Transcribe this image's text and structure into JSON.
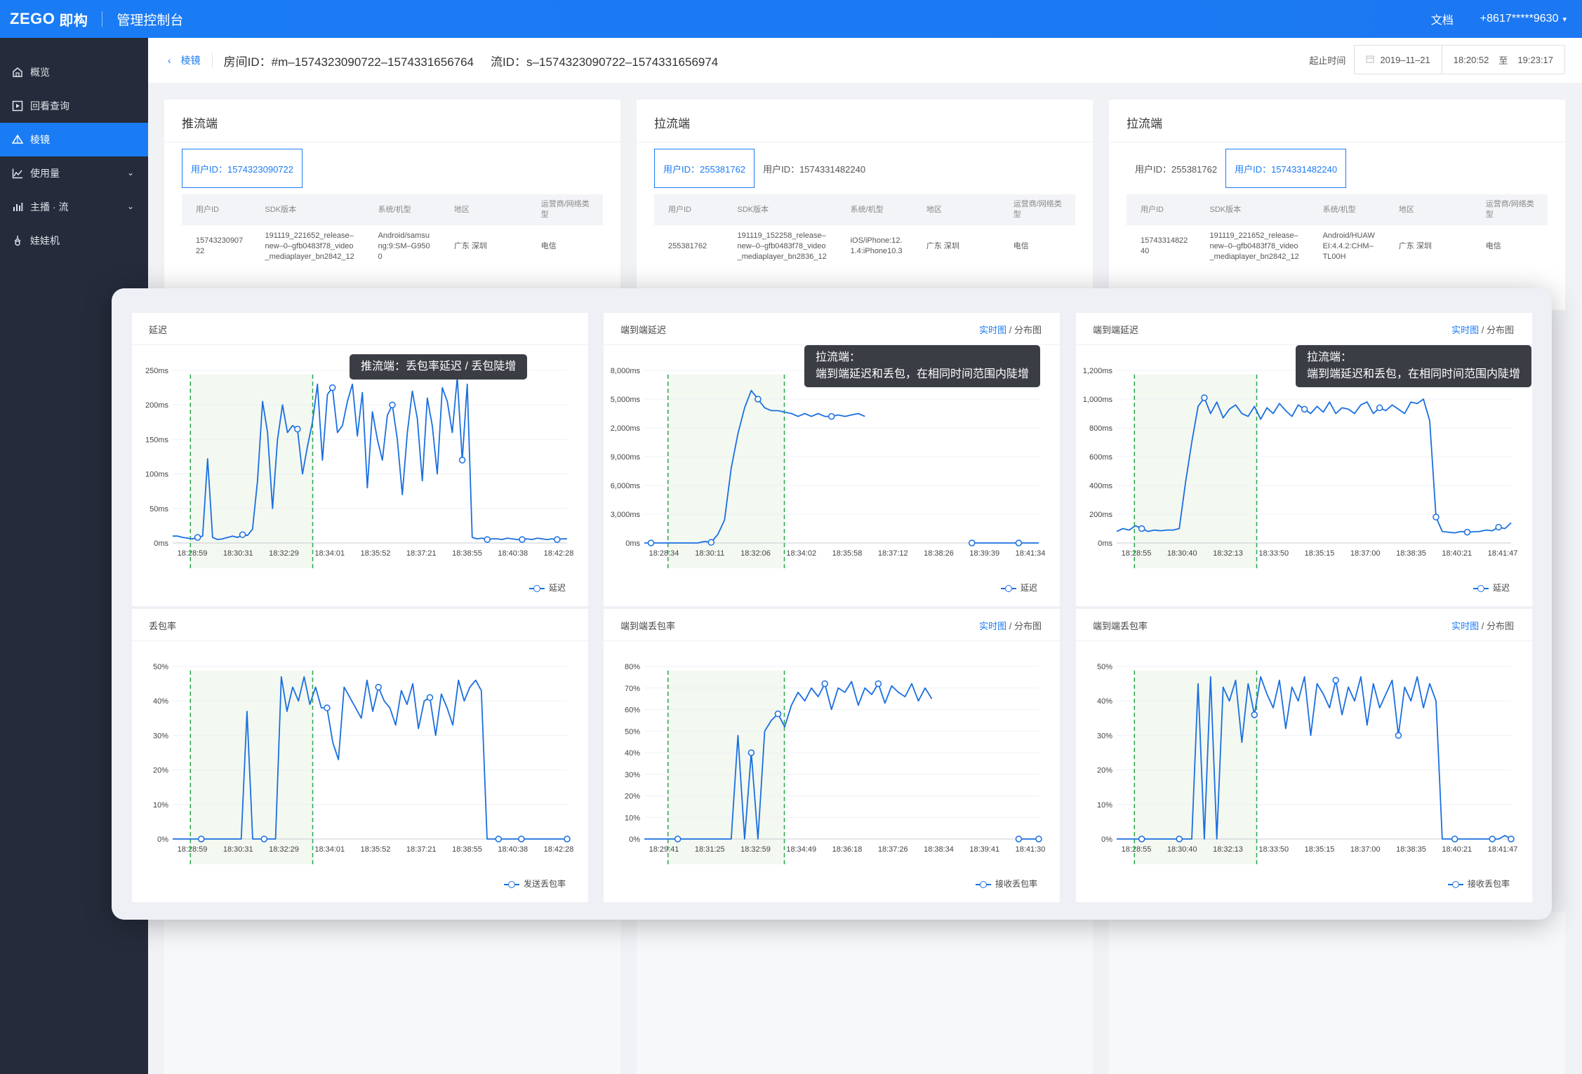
{
  "topbar": {
    "logo": "ZEGO",
    "logo_sub": "即构",
    "console_title": "管理控制台",
    "docs": "文档",
    "account": "+8617*****9630"
  },
  "sidebar": {
    "items": [
      {
        "label": "概览",
        "icon": "home-icon"
      },
      {
        "label": "回看查询",
        "icon": "playback-icon"
      },
      {
        "label": "棱镜",
        "icon": "prism-icon",
        "active": true
      },
      {
        "label": "使用量",
        "icon": "area-chart-icon",
        "expandable": true
      },
      {
        "label": "主播 · 流",
        "icon": "bar-chart-icon",
        "expandable": true
      },
      {
        "label": "娃娃机",
        "icon": "claw-machine-icon"
      }
    ]
  },
  "header": {
    "back_label": "棱镜",
    "room_id": "房间ID：#m–1574323090722–1574331656764",
    "stream_id": "流ID：s–1574323090722–1574331656974",
    "time_label": "起止时间",
    "date": "2019–11–21",
    "start_time": "18:20:52",
    "to": "至",
    "end_time": "19:23:17"
  },
  "endpoints": [
    {
      "title": "推流端",
      "users": [
        {
          "label": "用户ID：1574323090722",
          "selected": true
        }
      ],
      "columns": [
        "用户ID",
        "SDK版本",
        "系统/机型",
        "地区",
        "运营商/网络类型"
      ],
      "row": [
        "1574323090722",
        "191119_221652_release–new–0–gfb0483f78_video_mediaplayer_bn2842_12",
        "Android/samsung:9:SM–G9500",
        "广东 深圳",
        "电信"
      ]
    },
    {
      "title": "拉流端",
      "users": [
        {
          "label": "用户ID：255381762",
          "selected": true
        },
        {
          "label": "用户ID：1574331482240",
          "selected": false
        }
      ],
      "columns": [
        "用户ID",
        "SDK版本",
        "系统/机型",
        "地区",
        "运营商/网络类型"
      ],
      "row": [
        "255381762",
        "191119_152258_release–new–0–gfb0483f78_video_mediaplayer_bn2836_12",
        "iOS/iPhone:12.1.4:iPhone10.3",
        "广东 深圳",
        "电信"
      ]
    },
    {
      "title": "拉流端",
      "users": [
        {
          "label": "用户ID：255381762",
          "selected": false
        },
        {
          "label": "用户ID：1574331482240",
          "selected": true
        }
      ],
      "columns": [
        "用户ID",
        "SDK版本",
        "系统/机型",
        "地区",
        "运营商/网络类型"
      ],
      "row": [
        "1574331482240",
        "191119_221652_release–new–0–gfb0483f78_video_mediaplayer_bn2842_12",
        "Android/HUAWEI:4.4.2:CHM–TL00H",
        "广东 深圳",
        "电信"
      ]
    }
  ],
  "switch": {
    "realtime": "实时图",
    "sep": "/",
    "distribution": "分布图"
  },
  "tooltips": {
    "push": "推流端：丢包率延迟 / 丢包陡增",
    "pull_1_title": "拉流端：",
    "pull_1_body": "端到端延迟和丢包，在相同时间范围内陡增",
    "pull_2_title": "拉流端：",
    "pull_2_body": "端到端延迟和丢包，在相同时间范围内陡增"
  },
  "colors": {
    "accent": "#1a7cf5",
    "line": "#1a6fe0",
    "highlight": "#f3f8f1",
    "guide": "#2aa84a"
  },
  "chart_data": [
    {
      "id": "push-delay",
      "type": "line",
      "title": "延迟",
      "legend": "延迟",
      "y_ticks": [
        "250ms",
        "200ms",
        "150ms",
        "100ms",
        "50ms",
        "0ms"
      ],
      "ylim": [
        0,
        250
      ],
      "x_ticks": [
        "18:28:59",
        "18:30:31",
        "18:32:29",
        "18:34:01",
        "18:35:52",
        "18:37:21",
        "18:38:55",
        "18:40:38",
        "18:42:28"
      ],
      "values": [
        10,
        10,
        8,
        7,
        6,
        8,
        10,
        122,
        8,
        5,
        6,
        8,
        10,
        8,
        12,
        11,
        20,
        90,
        205,
        160,
        50,
        150,
        200,
        160,
        170,
        165,
        100,
        140,
        175,
        230,
        120,
        215,
        225,
        160,
        170,
        205,
        230,
        155,
        218,
        80,
        190,
        150,
        120,
        185,
        200,
        150,
        70,
        160,
        220,
        180,
        90,
        210,
        170,
        100,
        225,
        205,
        160,
        240,
        120,
        230,
        8,
        6,
        7,
        5,
        6,
        6,
        5,
        7,
        6,
        5,
        5,
        6,
        5,
        7,
        6,
        5,
        6,
        5,
        6,
        6
      ],
      "markers": [
        5,
        14,
        25,
        32,
        44,
        58,
        63,
        70,
        77
      ],
      "shade": [
        0.045,
        0.355
      ]
    },
    {
      "id": "push-loss",
      "type": "line",
      "title": "丢包率",
      "legend": "发送丢包率",
      "y_ticks": [
        "50%",
        "40%",
        "30%",
        "20%",
        "10%",
        "0%"
      ],
      "ylim": [
        0,
        50
      ],
      "x_ticks": [
        "18:28:59",
        "18:30:31",
        "18:32:29",
        "18:34:01",
        "18:35:52",
        "18:37:21",
        "18:38:55",
        "18:40:38",
        "18:42:28"
      ],
      "values": [
        0,
        0,
        0,
        0,
        0,
        0,
        0,
        0,
        0,
        0,
        0,
        0,
        0,
        37,
        0,
        0,
        0,
        0,
        0,
        47,
        37,
        44,
        40,
        47,
        39,
        44,
        38,
        38,
        28,
        23,
        44,
        41,
        38,
        35,
        46,
        37,
        44,
        40,
        38,
        33,
        43,
        39,
        45,
        32,
        40,
        41,
        30,
        42,
        38,
        33,
        46,
        40,
        44,
        46,
        43,
        0,
        0,
        0,
        0,
        0,
        0,
        0,
        0,
        0,
        0,
        0,
        0,
        0,
        0,
        0
      ],
      "markers": [
        5,
        16,
        27,
        36,
        45,
        57,
        61,
        69,
        76
      ],
      "shade": [
        0.045,
        0.355
      ]
    },
    {
      "id": "pull1-delay",
      "type": "line",
      "title": "端到端延迟",
      "legend": "延迟",
      "y_ticks": [
        "8,000ms",
        "5,000ms",
        "2,000ms",
        "9,000ms",
        "6,000ms",
        "3,000ms",
        "0ms"
      ],
      "ylim": [
        0,
        6
      ],
      "x_ticks": [
        "18:28:34",
        "18:30:11",
        "18:32:06",
        "18:34:02",
        "18:35:58",
        "18:37:12",
        "18:38:26",
        "18:39:39",
        "18:41:34"
      ],
      "values": [
        0,
        0,
        0,
        0,
        0,
        0,
        0,
        0,
        0,
        0.05,
        0.02,
        0.3,
        0.8,
        2.6,
        3.8,
        4.7,
        5.3,
        5.0,
        4.7,
        4.6,
        4.6,
        4.55,
        4.5,
        4.4,
        4.5,
        4.4,
        4.5,
        4.4,
        4.4,
        4.45,
        4.4,
        4.45,
        4.5,
        4.4,
        null,
        null,
        null,
        null,
        null,
        null,
        null,
        null,
        null,
        null,
        null,
        null,
        null,
        null,
        null,
        0,
        0,
        0,
        0,
        0,
        0,
        0,
        0,
        0,
        0,
        0
      ],
      "markers": [
        1,
        10,
        17,
        28,
        49,
        56
      ],
      "shade": [
        0.06,
        0.355
      ]
    },
    {
      "id": "pull1-loss",
      "type": "line",
      "title": "端到端丢包率",
      "legend": "接收丢包率",
      "y_ticks": [
        "80%",
        "70%",
        "60%",
        "50%",
        "40%",
        "30%",
        "20%",
        "10%",
        "0%"
      ],
      "ylim": [
        0,
        80
      ],
      "x_ticks": [
        "18:29:41",
        "18:31:25",
        "18:32:59",
        "18:34:49",
        "18:36:18",
        "18:37:26",
        "18:38:34",
        "18:39:41",
        "18:41:30"
      ],
      "values": [
        0,
        0,
        0,
        0,
        0,
        0,
        0,
        0,
        0,
        0,
        0,
        0,
        0,
        0,
        48,
        0,
        40,
        0,
        50,
        55,
        58,
        52,
        62,
        68,
        64,
        70,
        66,
        72,
        60,
        70,
        68,
        73,
        62,
        70,
        67,
        72,
        63,
        71,
        68,
        66,
        72,
        64,
        70,
        65,
        null,
        null,
        null,
        null,
        null,
        null,
        null,
        null,
        null,
        null,
        null,
        null,
        0,
        0,
        0,
        0
      ],
      "markers": [
        5,
        16,
        20,
        27,
        35,
        44,
        56,
        59
      ],
      "shade": [
        0.06,
        0.355
      ]
    },
    {
      "id": "pull2-delay",
      "type": "line",
      "title": "端到端延迟",
      "legend": "延迟",
      "y_ticks": [
        "1,200ms",
        "1,000ms",
        "800ms",
        "600ms",
        "400ms",
        "200ms",
        "0ms"
      ],
      "ylim": [
        0,
        1200
      ],
      "x_ticks": [
        "18:28:55",
        "18:30:40",
        "18:32:13",
        "18:33:50",
        "18:35:15",
        "18:37:00",
        "18:38:35",
        "18:40:21",
        "18:41:47"
      ],
      "values": [
        80,
        100,
        90,
        120,
        100,
        80,
        90,
        85,
        90,
        90,
        100,
        420,
        700,
        950,
        1010,
        900,
        980,
        870,
        930,
        960,
        900,
        880,
        950,
        860,
        940,
        900,
        970,
        920,
        880,
        960,
        930,
        900,
        950,
        910,
        980,
        900,
        940,
        930,
        900,
        960,
        980,
        900,
        940,
        920,
        960,
        930,
        900,
        980,
        970,
        1000,
        850,
        180,
        80,
        75,
        70,
        80,
        75,
        78,
        80,
        90,
        85,
        110,
        100,
        140
      ],
      "markers": [
        4,
        14,
        30,
        42,
        51,
        56,
        61
      ],
      "shade": [
        0.045,
        0.355
      ]
    },
    {
      "id": "pull2-loss",
      "type": "line",
      "title": "端到端丢包率",
      "legend": "接收丢包率",
      "y_ticks": [
        "50%",
        "40%",
        "30%",
        "20%",
        "10%",
        "0%"
      ],
      "ylim": [
        0,
        50
      ],
      "x_ticks": [
        "18:28:55",
        "18:30:40",
        "18:32:13",
        "18:33:50",
        "18:35:15",
        "18:37:00",
        "18:38:35",
        "18:40:21",
        "18:41:47"
      ],
      "values": [
        0,
        0,
        0,
        0,
        0,
        0,
        0,
        0,
        0,
        0,
        0,
        0,
        0,
        45,
        0,
        47,
        0,
        44,
        40,
        46,
        28,
        45,
        36,
        47,
        42,
        38,
        46,
        32,
        44,
        40,
        47,
        30,
        45,
        42,
        38,
        46,
        36,
        44,
        40,
        47,
        33,
        45,
        38,
        42,
        46,
        30,
        44,
        40,
        47,
        38,
        45,
        40,
        0,
        0,
        0,
        0,
        0,
        0,
        0,
        0,
        0,
        0,
        1,
        0
      ],
      "markers": [
        4,
        10,
        22,
        35,
        45,
        54,
        60,
        63
      ],
      "shade": [
        0.045,
        0.355
      ]
    }
  ]
}
